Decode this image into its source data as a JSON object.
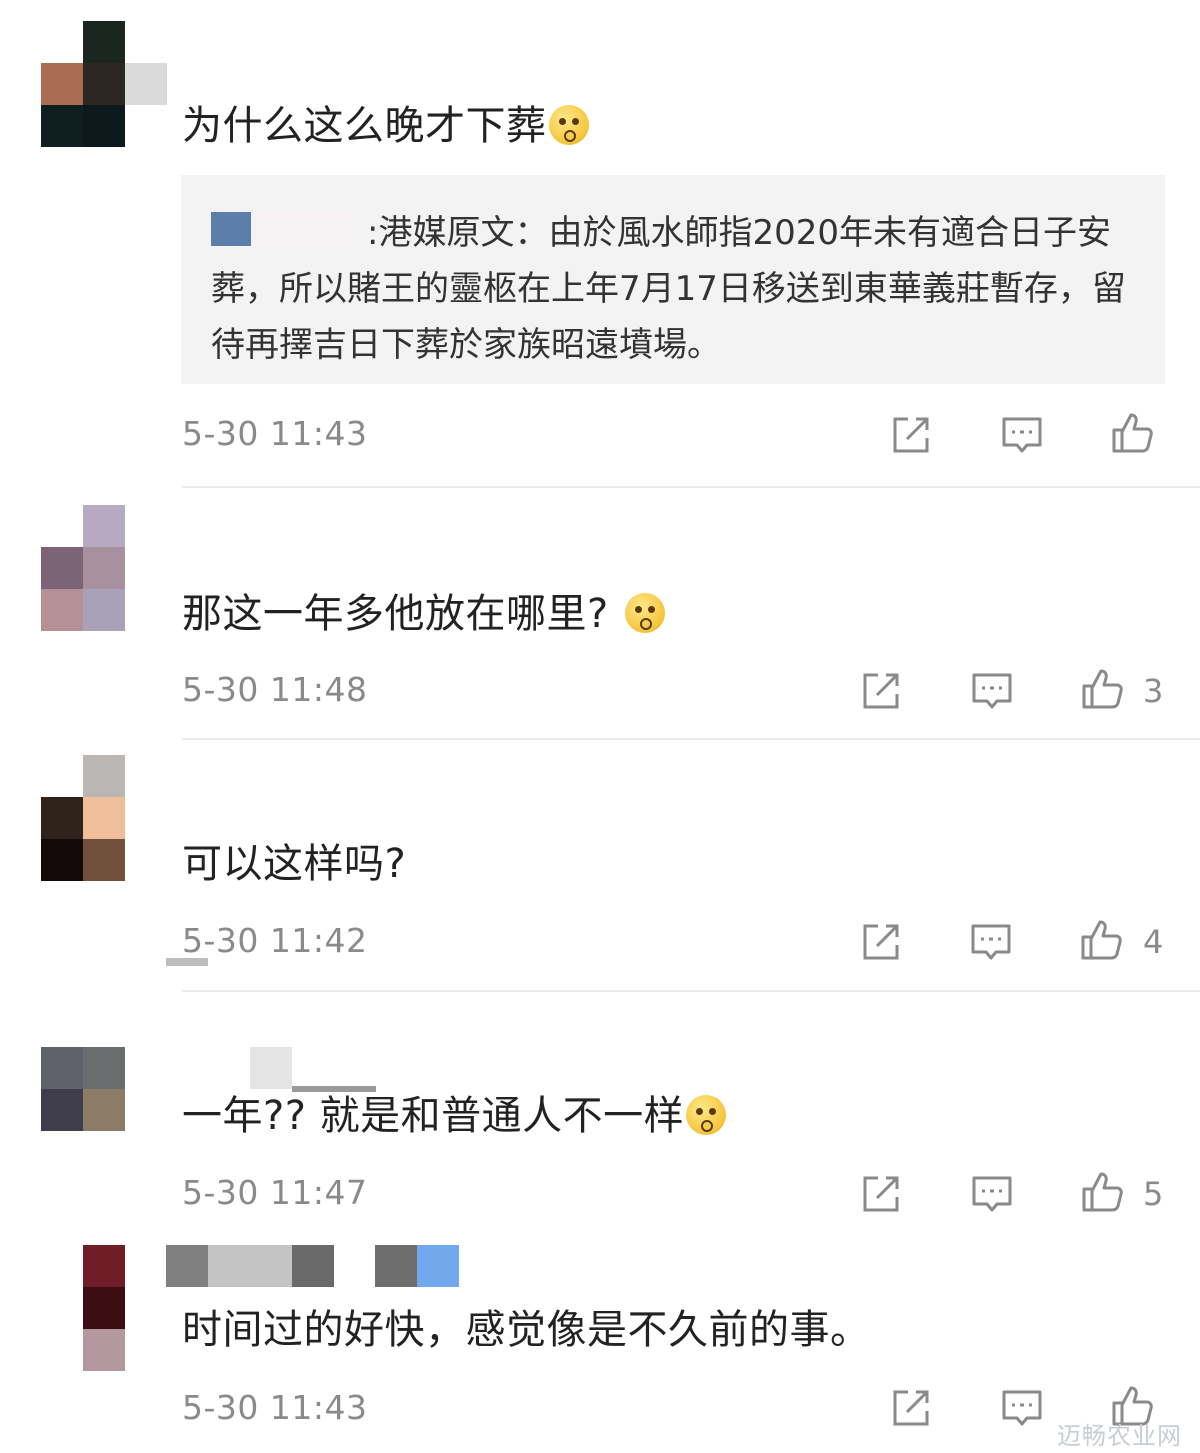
{
  "comments": [
    {
      "text": "为什么这么晚才下葬",
      "quote_label": ":",
      "quote": "港媒原文：由於風水師指2020年未有適合日子安葬，所以賭王的靈柩在上年7月17日移送到東華義莊暫存，留待再擇吉日下葬於家族昭遠墳場。",
      "time": "5-30 11:43",
      "likes": ""
    },
    {
      "text": "那这一年多他放在哪里?",
      "time": "5-30 11:48",
      "likes": "3"
    },
    {
      "text": "可以这样吗?",
      "time": "5-30 11:42",
      "likes": "4"
    },
    {
      "text": "一年?? 就是和普通人不一样",
      "time": "5-30 11:47",
      "likes": "5"
    },
    {
      "text": "时间过的好快，感觉像是不久前的事。",
      "time": "5-30 11:43",
      "likes": ""
    }
  ],
  "icons": [
    "share-icon",
    "reply-icon",
    "like-icon"
  ],
  "watermark": "迈畅农业网",
  "colors": {
    "meta_gray": "#8a8a8a",
    "quote_bg": "#f3f3f3",
    "divider": "#ececec"
  }
}
